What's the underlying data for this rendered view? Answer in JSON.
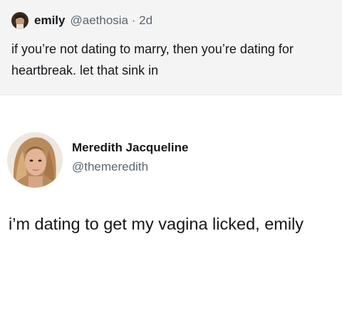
{
  "quoted_tweet": {
    "display_name": "emily",
    "handle": "@aethosia",
    "separator": "·",
    "time_ago": "2d",
    "text": "if you’re not dating to marry, then you’re dating for heartbreak. let that sink in"
  },
  "reply_tweet": {
    "display_name": "Meredith Jacqueline",
    "handle": "@themeredith",
    "text": "i’m dating to get my vagina licked, emily"
  },
  "colors": {
    "quoted_background": "#f4f4f4",
    "primary_text": "#14171a",
    "secondary_text": "#5b6670"
  },
  "icons": [
    "avatar-emily",
    "avatar-meredith"
  ]
}
